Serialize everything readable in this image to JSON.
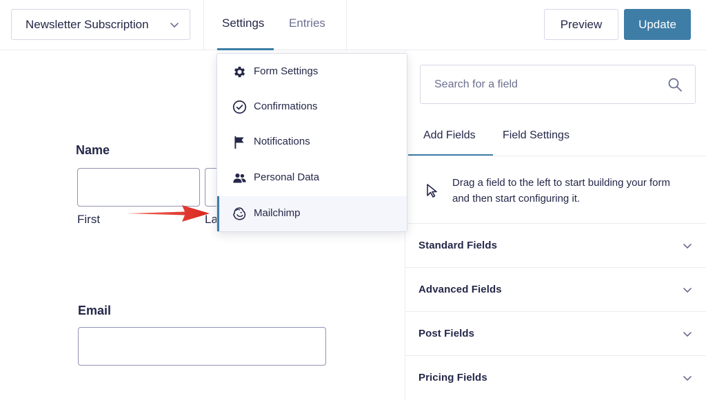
{
  "header": {
    "form_name": "Newsletter Subscription",
    "tabs": [
      {
        "label": "Settings",
        "active": true
      },
      {
        "label": "Entries",
        "active": false
      }
    ],
    "preview_label": "Preview",
    "update_label": "Update"
  },
  "settings_menu": {
    "items": [
      {
        "label": "Form Settings",
        "icon": "gear-icon"
      },
      {
        "label": "Confirmations",
        "icon": "check-circle-icon"
      },
      {
        "label": "Notifications",
        "icon": "flag-icon"
      },
      {
        "label": "Personal Data",
        "icon": "users-icon"
      },
      {
        "label": "Mailchimp",
        "icon": "mailchimp-icon",
        "highlighted": true
      }
    ]
  },
  "canvas": {
    "name_field": {
      "label": "Name",
      "first_label": "First",
      "last_label": "La"
    },
    "email_field": {
      "label": "Email"
    }
  },
  "panel": {
    "search_placeholder": "Search for a field",
    "tabs": [
      {
        "label": "Add Fields",
        "active": true
      },
      {
        "label": "Field Settings",
        "active": false
      }
    ],
    "hint": "Drag a field to the left to start building your form and then start configuring it.",
    "sections": [
      "Standard Fields",
      "Advanced Fields",
      "Post Fields",
      "Pricing Fields"
    ]
  },
  "colors": {
    "accent": "#3e7da6",
    "annotation_arrow": "#e0332f",
    "text": "#242748"
  }
}
